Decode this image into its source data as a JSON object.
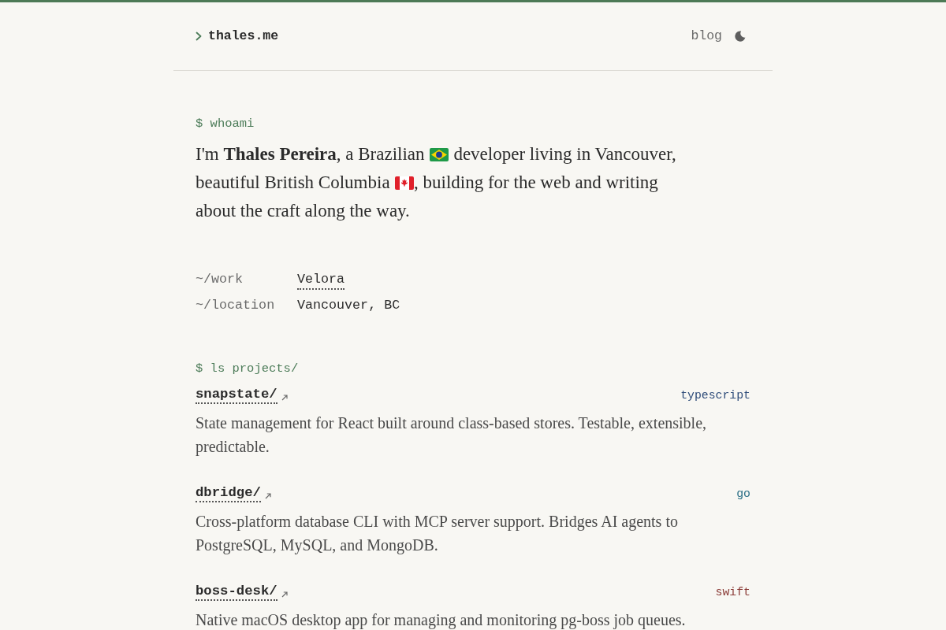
{
  "header": {
    "site_name": "thales.me",
    "nav_link": "blog"
  },
  "intro": {
    "prompt": "$ whoami",
    "bio": [
      "I'm **Thales Pereira**, a Brazilian",
      "developer living in Vancouver, beautiful British Columbia",
      ", building for the web and writing about the craft along the way."
    ]
  },
  "info": [
    {
      "label": "~/work",
      "value": "Velora",
      "kind": "link"
    },
    {
      "label": "~/location",
      "value": "Vancouver, BC",
      "kind": "text"
    }
  ],
  "projects": {
    "prompt": "$ ls projects/",
    "items": [
      {
        "name": "snapstate/",
        "tag": "typescript",
        "color": "#2c4a78",
        "description": "State management for React built around class-based stores. Testable, extensible, predictable."
      },
      {
        "name": "dbridge/",
        "tag": "go",
        "color": "#2b6f86",
        "description": "Cross-platform database CLI with MCP server support. Bridges AI agents to PostgreSQL, MySQL, and MongoDB."
      },
      {
        "name": "boss-desk/",
        "tag": "swift",
        "color": "#8a3b36",
        "description": "Native macOS desktop app for managing and monitoring pg-boss job queues."
      }
    ]
  }
}
